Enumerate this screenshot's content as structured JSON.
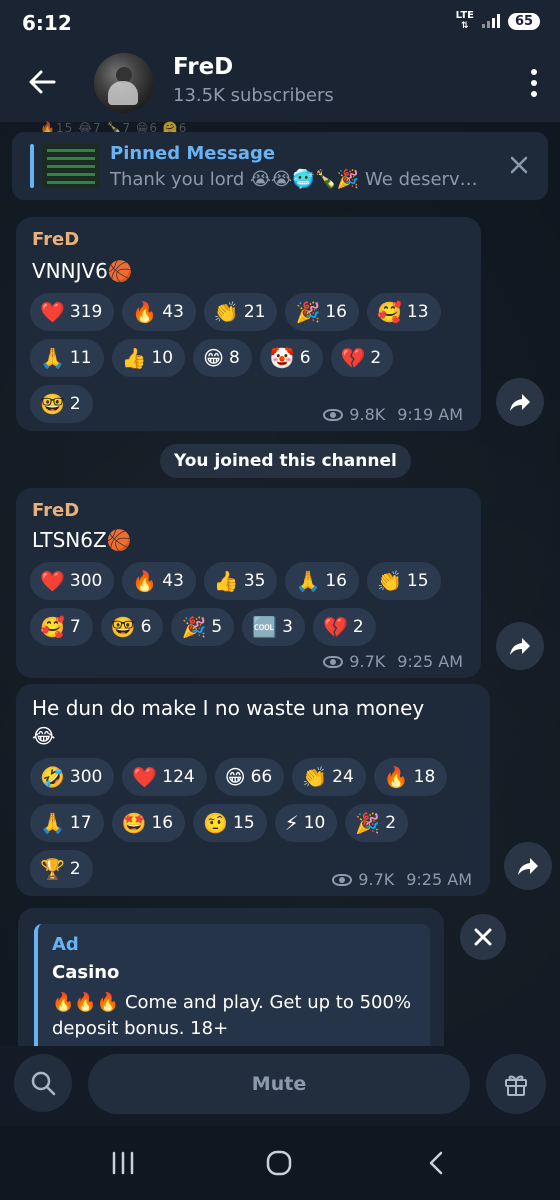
{
  "status": {
    "time": "6:12",
    "network": "LTE",
    "battery": "65"
  },
  "header": {
    "title": "FreD",
    "subtitle": "13.5K subscribers"
  },
  "peek_reactions": "🔥15  😂7  🍾7  😁6  🤗6",
  "pinned": {
    "title": "Pinned Message",
    "text": "Thank you lord 😭😭🥶🍾🎉 We deserv…"
  },
  "messages": [
    {
      "sender": "FreD",
      "text": "VNNJV6🏀",
      "reactions": [
        [
          {
            "e": "❤️",
            "c": "319"
          },
          {
            "e": "🔥",
            "c": "43"
          },
          {
            "e": "👏",
            "c": "21"
          },
          {
            "e": "🎉",
            "c": "16"
          },
          {
            "e": "🥰",
            "c": "13"
          }
        ],
        [
          {
            "e": "🙏",
            "c": "11"
          },
          {
            "e": "👍",
            "c": "10"
          },
          {
            "e": "😁",
            "c": "8"
          },
          {
            "e": "🤡",
            "c": "6"
          },
          {
            "e": "💔",
            "c": "2"
          }
        ],
        [
          {
            "e": "🤓",
            "c": "2"
          }
        ]
      ],
      "views": "9.8K",
      "time": "9:19 AM"
    },
    {
      "sender": "FreD",
      "text": "LTSN6Z🏀",
      "reactions": [
        [
          {
            "e": "❤️",
            "c": "300"
          },
          {
            "e": "🔥",
            "c": "43"
          },
          {
            "e": "👍",
            "c": "35"
          },
          {
            "e": "🙏",
            "c": "16"
          },
          {
            "e": "👏",
            "c": "15"
          }
        ],
        [
          {
            "e": "🥰",
            "c": "7"
          },
          {
            "e": "🤓",
            "c": "6"
          },
          {
            "e": "🎉",
            "c": "5"
          },
          {
            "e": "🆒",
            "c": "3"
          },
          {
            "e": "💔",
            "c": "2"
          }
        ]
      ],
      "views": "9.7K",
      "time": "9:25 AM"
    },
    {
      "text_line1": "He dun do make I no waste una money",
      "text_line2": "😂",
      "reactions": [
        [
          {
            "e": "🤣",
            "c": "300"
          },
          {
            "e": "❤️",
            "c": "124"
          },
          {
            "e": "😁",
            "c": "66"
          },
          {
            "e": "👏",
            "c": "24"
          },
          {
            "e": "🔥",
            "c": "18"
          }
        ],
        [
          {
            "e": "🙏",
            "c": "17"
          },
          {
            "e": "🤩",
            "c": "16"
          },
          {
            "e": "🤨",
            "c": "15"
          },
          {
            "e": "⚡",
            "c": "10"
          },
          {
            "e": "🎉",
            "c": "2"
          }
        ],
        [
          {
            "e": "🏆",
            "c": "2"
          }
        ]
      ],
      "views": "9.7K",
      "time": "9:25 AM"
    }
  ],
  "service": {
    "joined": "You joined this channel"
  },
  "ad": {
    "label": "Ad",
    "name": "Casino",
    "body": "🔥🔥🔥 Come and play. Get up to 500% deposit bonus. 18+"
  },
  "bottom": {
    "mute": "Mute"
  },
  "colors": {
    "accent": "#6ab3f3",
    "sender": "#e8b07a",
    "bubble": "#1e2a39",
    "chip": "#2b3a4e"
  }
}
